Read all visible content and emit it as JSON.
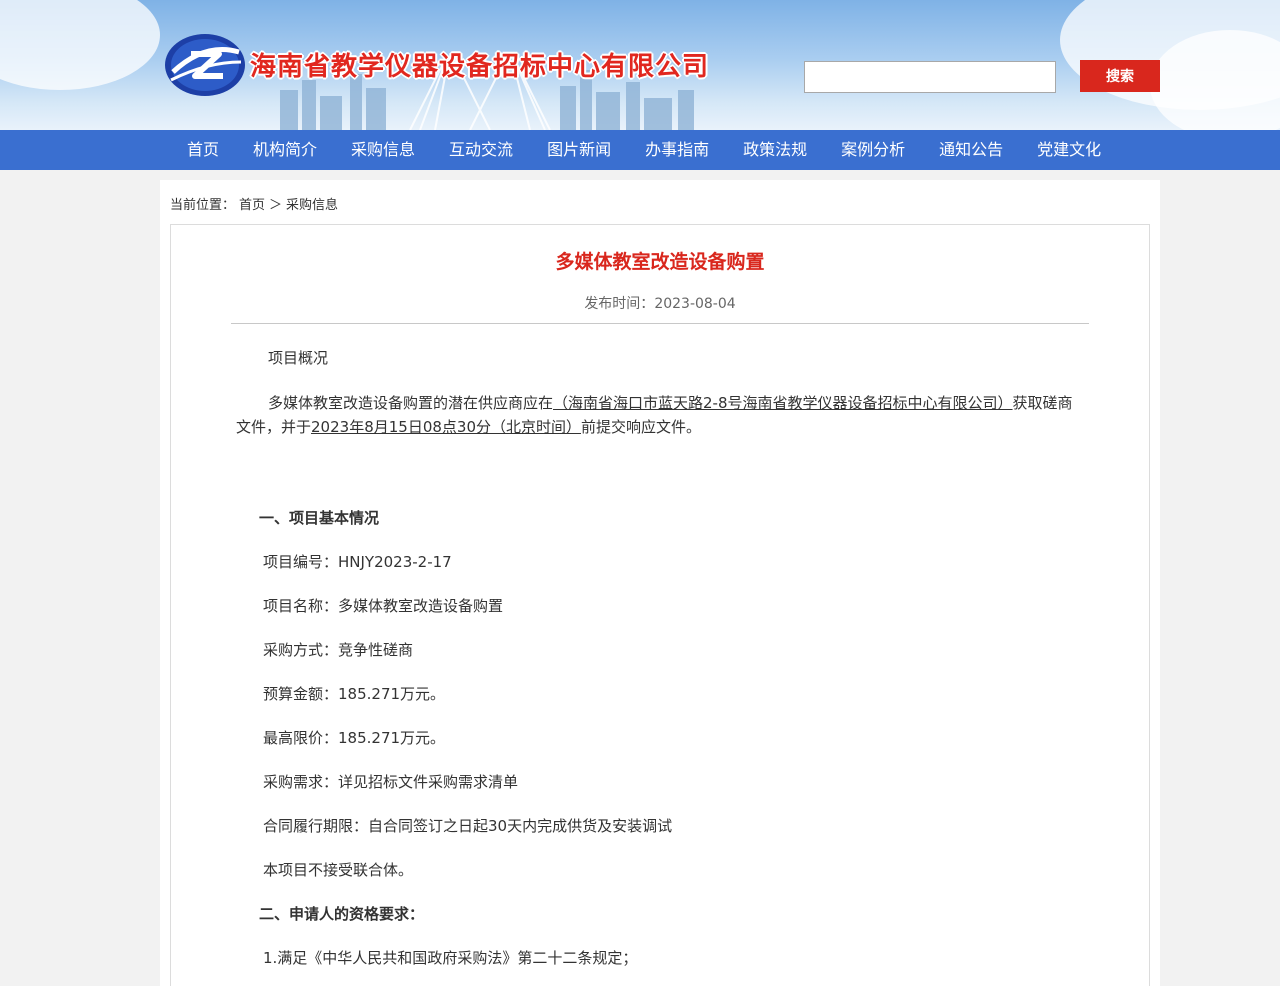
{
  "header": {
    "site_title": "海南省教学仪器设备招标中心有限公司",
    "search": {
      "placeholder": "",
      "value": "",
      "button_label": "搜索"
    }
  },
  "nav": {
    "items": [
      "首页",
      "机构简介",
      "采购信息",
      "互动交流",
      "图片新闻",
      "办事指南",
      "政策法规",
      "案例分析",
      "通知公告",
      "党建文化"
    ]
  },
  "breadcrumb": {
    "prefix": "当前位置：",
    "items": [
      "首页",
      "采购信息"
    ],
    "separator": "＞"
  },
  "article": {
    "title": "多媒体教室改造设备购置",
    "publish_label": "发布时间：",
    "publish_date": "2023-08-04",
    "overview_heading": "项目概况",
    "intro_part1": "多媒体教室改造设备购置的潜在供应商应在",
    "intro_location": "（海南省海口市蓝天路2-8号海南省教学仪器设备招标中心有限公司）",
    "intro_part2": "获取磋商文件，并于",
    "intro_deadline": "2023年8月15日08点30分（北京时间）",
    "intro_part3": "前提交响应文件。",
    "section1_heading": "一、项目基本情况",
    "section1_lines": [
      "项目编号：HNJY2023-2-17",
      "项目名称：多媒体教室改造设备购置",
      "采购方式：竞争性磋商",
      "预算金额：185.271万元。",
      "最高限价：185.271万元。",
      "采购需求：详见招标文件采购需求清单",
      "合同履行期限：自合同签订之日起30天内完成供货及安装调试",
      "本项目不接受联合体。"
    ],
    "section2_heading": "二、申请人的资格要求：",
    "section2_lines": [
      "1.满足《中华人民共和国政府采购法》第二十二条规定；"
    ]
  },
  "colors": {
    "nav_background": "#3a6fd0",
    "accent_red": "#d9271d",
    "page_background": "#f2f2f2"
  }
}
